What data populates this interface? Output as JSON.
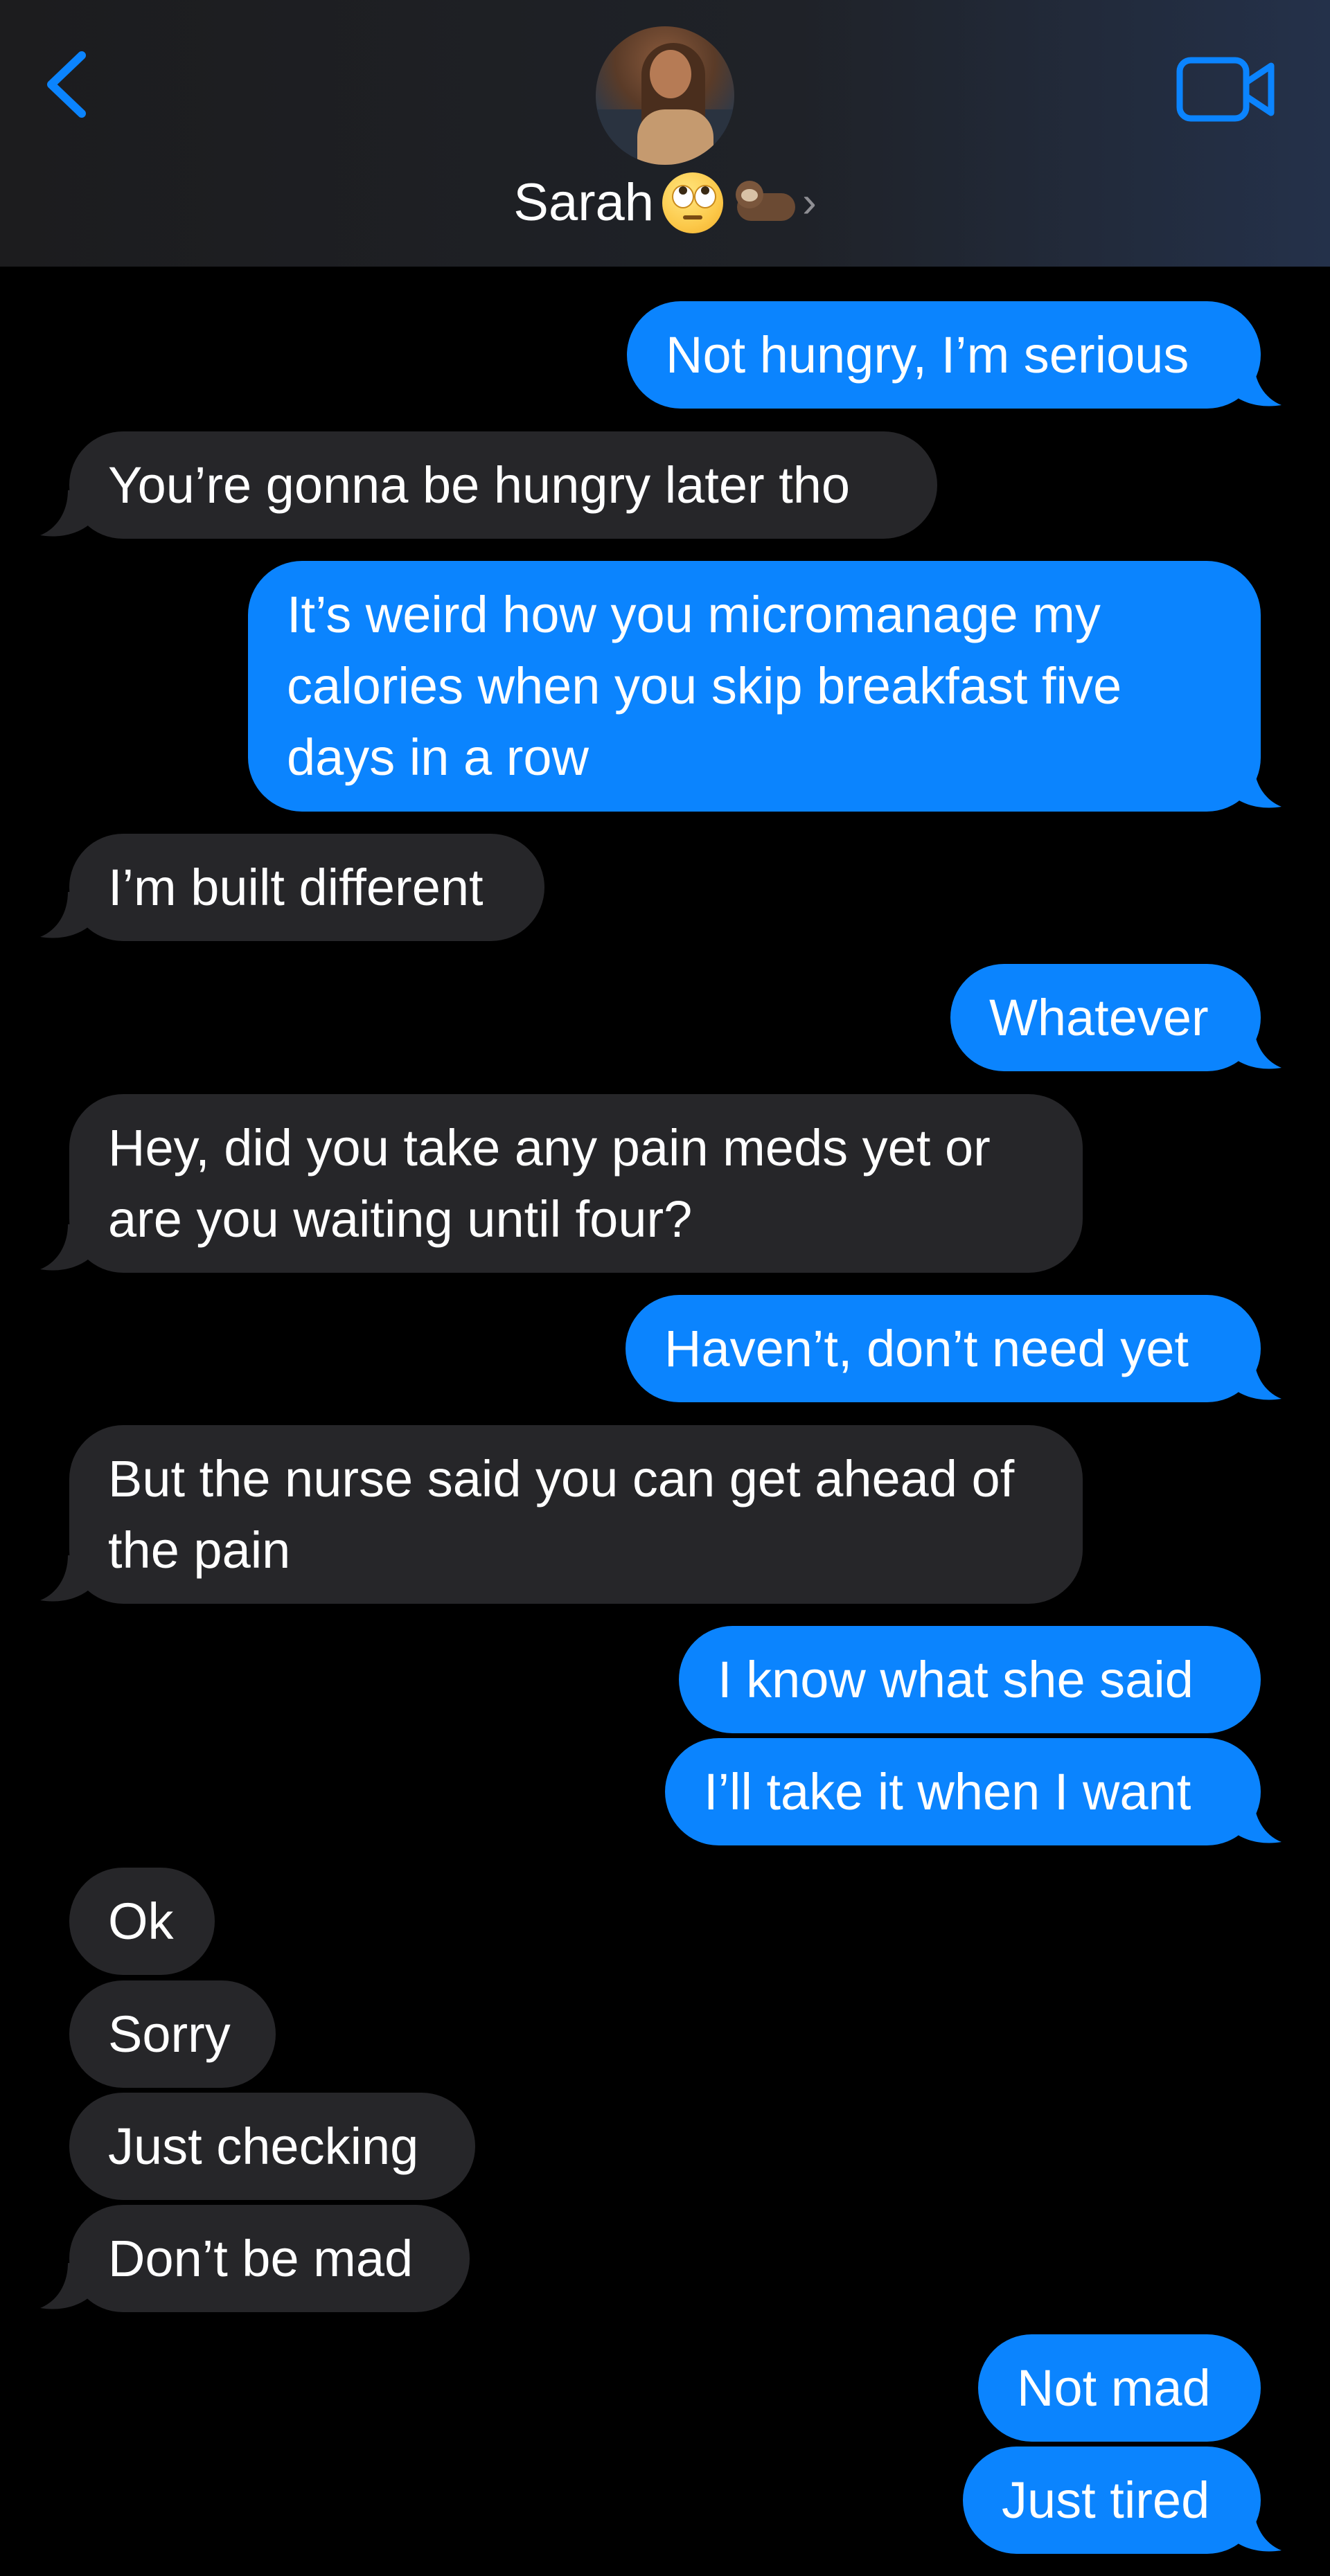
{
  "header": {
    "contact_name": "Sarah",
    "contact_emoji_1": "face-with-rolling-eyes",
    "contact_emoji_2": "otter",
    "back_icon": "chevron-left-icon",
    "video_icon": "video-camera-icon",
    "accent_color": "#0b84fe"
  },
  "messages": [
    {
      "side": "sent",
      "text": "Not hungry, I’m serious"
    },
    {
      "side": "received",
      "text": "You’re gonna be hungry later tho"
    },
    {
      "side": "sent",
      "text": "It’s weird how you micromanage my calories when you skip breakfast five days in a row"
    },
    {
      "side": "received",
      "text": "I’m built different"
    },
    {
      "side": "sent",
      "text": "Whatever"
    },
    {
      "side": "received",
      "text": "Hey, did you take any pain meds yet or are you waiting until four?"
    },
    {
      "side": "sent",
      "text": "Haven’t, don’t need yet"
    },
    {
      "side": "received",
      "text": "But the nurse said you can get ahead of the pain"
    },
    {
      "side": "sent",
      "text": "I know what she said"
    },
    {
      "side": "sent",
      "text": "I’ll take it when I want"
    },
    {
      "side": "received",
      "text": "Ok"
    },
    {
      "side": "received",
      "text": "Sorry"
    },
    {
      "side": "received",
      "text": "Just checking"
    },
    {
      "side": "received",
      "text": "Don’t be mad"
    },
    {
      "side": "sent",
      "text": "Not mad"
    },
    {
      "side": "sent",
      "text": "Just tired"
    }
  ],
  "colors": {
    "sent_bubble": "#0b84fe",
    "received_bubble": "#262629",
    "background": "#000000"
  }
}
